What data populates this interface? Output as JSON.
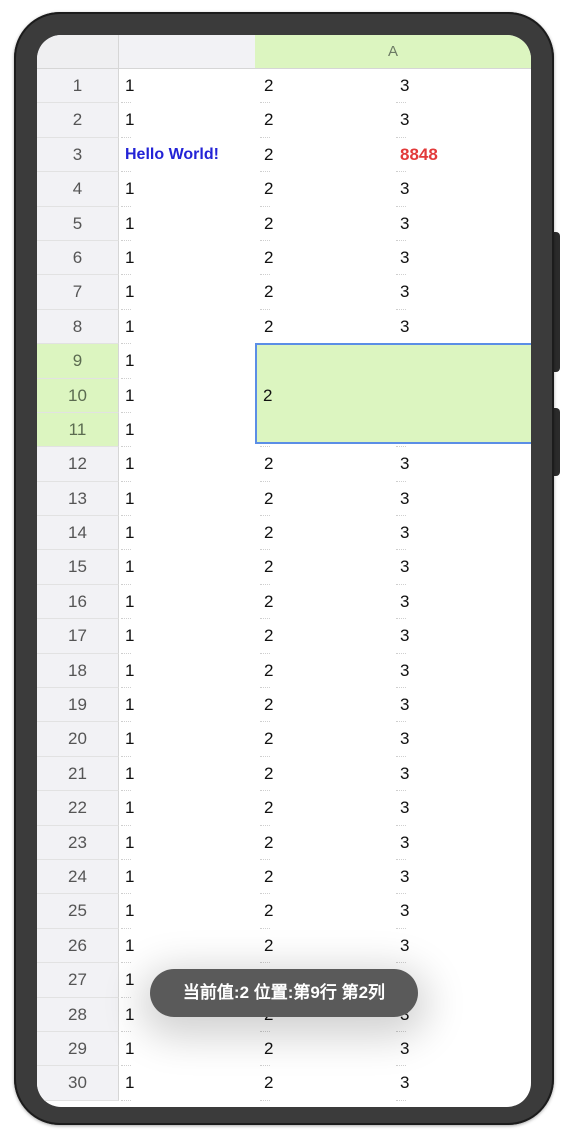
{
  "sheet": {
    "column_header": "A",
    "rows": [
      {
        "num": "1",
        "c1": "1",
        "c2": "2",
        "c3": "3"
      },
      {
        "num": "2",
        "c1": "1",
        "c2": "2",
        "c3": "3"
      },
      {
        "num": "3",
        "c1": "Hello World!",
        "c2": "2",
        "c3": "8848"
      },
      {
        "num": "4",
        "c1": "1",
        "c2": "2",
        "c3": "3"
      },
      {
        "num": "5",
        "c1": "1",
        "c2": "2",
        "c3": "3"
      },
      {
        "num": "6",
        "c1": "1",
        "c2": "2",
        "c3": "3"
      },
      {
        "num": "7",
        "c1": "1",
        "c2": "2",
        "c3": "3"
      },
      {
        "num": "8",
        "c1": "1",
        "c2": "2",
        "c3": "3"
      },
      {
        "num": "9",
        "c1": "1",
        "c2": "",
        "c3": ""
      },
      {
        "num": "10",
        "c1": "1",
        "c2": "",
        "c3": ""
      },
      {
        "num": "11",
        "c1": "1",
        "c2": "",
        "c3": ""
      },
      {
        "num": "12",
        "c1": "1",
        "c2": "2",
        "c3": "3"
      },
      {
        "num": "13",
        "c1": "1",
        "c2": "2",
        "c3": "3"
      },
      {
        "num": "14",
        "c1": "1",
        "c2": "2",
        "c3": "3"
      },
      {
        "num": "15",
        "c1": "1",
        "c2": "2",
        "c3": "3"
      },
      {
        "num": "16",
        "c1": "1",
        "c2": "2",
        "c3": "3"
      },
      {
        "num": "17",
        "c1": "1",
        "c2": "2",
        "c3": "3"
      },
      {
        "num": "18",
        "c1": "1",
        "c2": "2",
        "c3": "3"
      },
      {
        "num": "19",
        "c1": "1",
        "c2": "2",
        "c3": "3"
      },
      {
        "num": "20",
        "c1": "1",
        "c2": "2",
        "c3": "3"
      },
      {
        "num": "21",
        "c1": "1",
        "c2": "2",
        "c3": "3"
      },
      {
        "num": "22",
        "c1": "1",
        "c2": "2",
        "c3": "3"
      },
      {
        "num": "23",
        "c1": "1",
        "c2": "2",
        "c3": "3"
      },
      {
        "num": "24",
        "c1": "1",
        "c2": "2",
        "c3": "3"
      },
      {
        "num": "25",
        "c1": "1",
        "c2": "2",
        "c3": "3"
      },
      {
        "num": "26",
        "c1": "1",
        "c2": "2",
        "c3": "3"
      },
      {
        "num": "27",
        "c1": "1",
        "c2": "2",
        "c3": "3"
      },
      {
        "num": "28",
        "c1": "1",
        "c2": "2",
        "c3": "3"
      },
      {
        "num": "29",
        "c1": "1",
        "c2": "2",
        "c3": "3"
      },
      {
        "num": "30",
        "c1": "1",
        "c2": "2",
        "c3": "3"
      }
    ],
    "merged_cell_value": "2",
    "hello_color": "#2323d6",
    "highlight_color": "#e23a3a",
    "selection_fill": "#dcf5c0",
    "selection_border": "#5b8ee6"
  },
  "toast": {
    "text": "当前值:2 位置:第9行 第2列"
  }
}
